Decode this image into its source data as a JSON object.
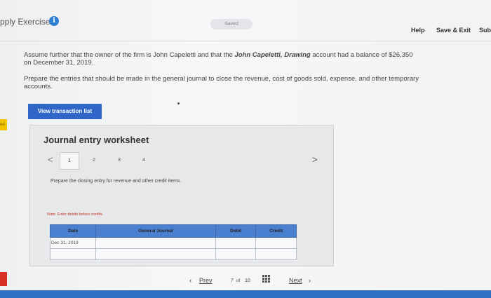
{
  "header": {
    "app_title": "pply Exercise",
    "info_icon": "i",
    "saved": "Saved",
    "help": "Help",
    "save_exit": "Save & Exit",
    "submit": "Sub"
  },
  "intro": {
    "line1_a": "Assume further that the owner of the firm is John Capeletti and that the ",
    "line1_em": "John Capeletti, Drawing",
    "line1_b": " account had a balance of $26,350",
    "line2": "on December 31, 2019.",
    "prepare1": "Prepare the entries that should be made in the general journal to close the revenue, cost of goods sold, expense, and other temporary",
    "prepare2": "accounts."
  },
  "view_button": "View transaction list",
  "left_tab": "ed",
  "worksheet": {
    "title": "Journal entry worksheet",
    "prev": "<",
    "next": ">",
    "steps": [
      "1",
      "2",
      "3",
      "4"
    ],
    "instruction": "Prepare the closing entry for revenue and other credit items.",
    "note": "Note: Enter debits before credits.",
    "table": {
      "headers": [
        "Date",
        "General Journal",
        "Debit",
        "Credit"
      ],
      "rows": [
        [
          "Dec 31, 2019",
          "",
          "",
          ""
        ],
        [
          "",
          "",
          "",
          ""
        ]
      ]
    }
  },
  "pager": {
    "prev": "Prev",
    "current": "7",
    "of": "of",
    "total": "10",
    "next": "Next"
  }
}
